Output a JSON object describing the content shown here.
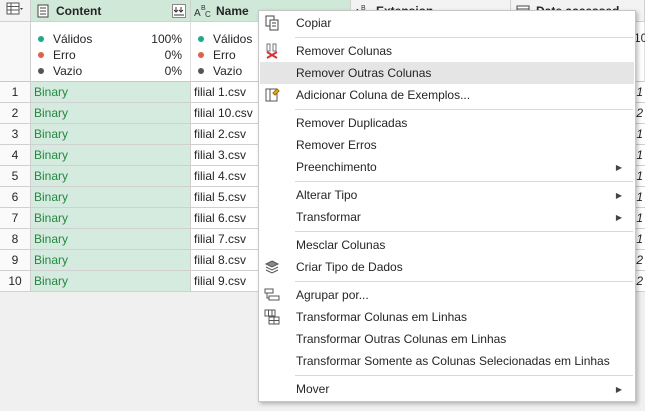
{
  "headers": {
    "content": {
      "type": "doc",
      "label": "Content"
    },
    "name": {
      "type": "ABC",
      "label": "Name"
    },
    "extension": {
      "type": "ABC",
      "label": "Extension"
    },
    "date": {
      "type": "cal",
      "label": "Date accessed"
    }
  },
  "quality": {
    "content": [
      {
        "label": "Válidos",
        "pct": "100%",
        "color": "#1fa98c"
      },
      {
        "label": "Erro",
        "pct": "0%",
        "color": "#e06246"
      },
      {
        "label": "Vazio",
        "pct": "0%",
        "color": "#555555"
      }
    ],
    "name": [
      {
        "label": "Válidos",
        "color": "#1fa98c"
      },
      {
        "label": "Erro",
        "color": "#e06246"
      },
      {
        "label": "Vazio",
        "color": "#555555"
      }
    ],
    "date_partial": "10"
  },
  "rows": [
    {
      "n": "1",
      "content": "Binary",
      "name": "filial 1.csv",
      "date": ":1"
    },
    {
      "n": "2",
      "content": "Binary",
      "name": "filial 10.csv",
      "date": ":2"
    },
    {
      "n": "3",
      "content": "Binary",
      "name": "filial 2.csv",
      "date": ":1"
    },
    {
      "n": "4",
      "content": "Binary",
      "name": "filial 3.csv",
      "date": ":1"
    },
    {
      "n": "5",
      "content": "Binary",
      "name": "filial 4.csv",
      "date": ":1"
    },
    {
      "n": "6",
      "content": "Binary",
      "name": "filial 5.csv",
      "date": ":1"
    },
    {
      "n": "7",
      "content": "Binary",
      "name": "filial 6.csv",
      "date": ":1"
    },
    {
      "n": "8",
      "content": "Binary",
      "name": "filial 7.csv",
      "date": ":1"
    },
    {
      "n": "9",
      "content": "Binary",
      "name": "filial 8.csv",
      "date": ":2"
    },
    {
      "n": "10",
      "content": "Binary",
      "name": "filial 9.csv",
      "date": ":2"
    }
  ],
  "menu": {
    "items": [
      {
        "label": "Copiar",
        "icon": "copy-icon"
      },
      {
        "label": "Remover Colunas",
        "icon": "remove-columns-icon"
      },
      {
        "label": "Remover Outras Colunas",
        "icon": "",
        "hover": true
      },
      {
        "label": "Adicionar Coluna de Exemplos...",
        "icon": "column-from-examples-icon"
      },
      {
        "label": "Remover Duplicadas",
        "icon": ""
      },
      {
        "label": "Remover Erros",
        "icon": ""
      },
      {
        "label": "Preenchimento",
        "icon": "",
        "submenu": true
      },
      {
        "label": "Alterar Tipo",
        "icon": "",
        "submenu": true
      },
      {
        "label": "Transformar",
        "icon": "",
        "submenu": true
      },
      {
        "label": "Mesclar Colunas",
        "icon": ""
      },
      {
        "label": "Criar Tipo de Dados",
        "icon": "data-type-icon"
      },
      {
        "label": "Agrupar por...",
        "icon": "group-by-icon"
      },
      {
        "label": "Transformar Colunas em Linhas",
        "icon": "unpivot-icon"
      },
      {
        "label": "Transformar Outras Colunas em Linhas",
        "icon": ""
      },
      {
        "label": "Transformar Somente as Colunas Selecionadas em Linhas",
        "icon": ""
      },
      {
        "label": "Mover",
        "icon": "",
        "submenu": true
      }
    ]
  }
}
